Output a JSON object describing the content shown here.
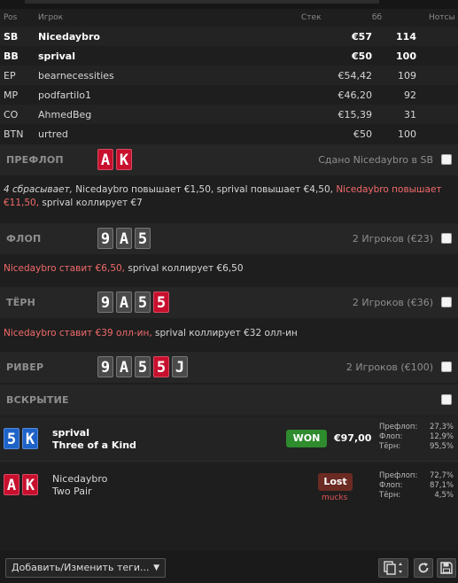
{
  "table": {
    "headers": {
      "pos": "Pos",
      "player": "Игрок",
      "stack": "Стек",
      "bb": "бб",
      "notes": "Нотсы"
    },
    "rows": [
      {
        "pos": "SB",
        "player": "Nicedaybro",
        "stack": "€57",
        "bb": "114",
        "bold": true
      },
      {
        "pos": "BB",
        "player": "sprival",
        "stack": "€50",
        "bb": "100",
        "bold": true
      },
      {
        "pos": "EP",
        "player": "bearnecessities",
        "stack": "€54,42",
        "bb": "109",
        "bold": false
      },
      {
        "pos": "MP",
        "player": "podfartilo1",
        "stack": "€46,20",
        "bb": "92",
        "bold": false
      },
      {
        "pos": "CO",
        "player": "AhmedBeg",
        "stack": "€15,39",
        "bb": "31",
        "bold": false
      },
      {
        "pos": "BTN",
        "player": "urtred",
        "stack": "€50",
        "bb": "100",
        "bold": false
      }
    ]
  },
  "preflop": {
    "label": "ПРЕФЛОП",
    "info": "Сдано Nicedaybro в SB",
    "action": {
      "fold": "4 сбрасывает,",
      "p1": " Nicedaybro повышает €1,50, sprival повышает €4,50, ",
      "hero": "Nicedaybro повышает €11,50,",
      "p2": " sprival коллирует €7"
    }
  },
  "flop": {
    "label": "ФЛОП",
    "info": "2 Игроков (€23)",
    "action": {
      "hero": "Nicedaybro ставит €6,50,",
      "rest": " sprival коллирует €6,50"
    }
  },
  "turn": {
    "label": "ТЁРН",
    "info": "2 Игроков (€36)",
    "action": {
      "hero": "Nicedaybro ставит €39 олл-ин,",
      "rest": " sprival коллирует €32 олл-ин"
    }
  },
  "river": {
    "label": "РИВЕР",
    "info": "2 Игроков (€100)"
  },
  "showdown": {
    "label": "ВСКРЫТИЕ",
    "winner": {
      "name": "sprival",
      "hand": "Three of a Kind",
      "badge": "WON",
      "amount": "€97,00",
      "eq": [
        {
          "k": "Префлоп:",
          "v": "27,3%"
        },
        {
          "k": "Флоп:",
          "v": "12,9%"
        },
        {
          "k": "Тёрн:",
          "v": "95,5%"
        }
      ]
    },
    "loser": {
      "name": "Nicedaybro",
      "hand": "Two Pair",
      "badge": "Lost",
      "note": "mucks",
      "eq": [
        {
          "k": "Префлоп:",
          "v": "72,7%"
        },
        {
          "k": "Флоп:",
          "v": "87,1%"
        },
        {
          "k": "Тёрн:",
          "v": "4,5%"
        }
      ]
    }
  },
  "cards": {
    "hero": [
      {
        "r": "A",
        "s": "h"
      },
      {
        "r": "K",
        "s": "h"
      }
    ],
    "board": [
      {
        "r": "9",
        "s": "s"
      },
      {
        "r": "A",
        "s": "s"
      },
      {
        "r": "5",
        "s": "s"
      },
      {
        "r": "5",
        "s": "h"
      },
      {
        "r": "J",
        "s": "s"
      }
    ],
    "villain": [
      {
        "r": "5",
        "s": "d"
      },
      {
        "r": "K",
        "s": "d"
      }
    ]
  },
  "footer": {
    "tags_label": "Добавить/Изменить теги...",
    "icons": [
      "copy-icon",
      "refresh-icon",
      "save-icon"
    ]
  },
  "colors": {
    "hearts": "#c8102e",
    "spades": "#4a4a4a",
    "diamonds": "#1e63c8",
    "hero_action": "#f26a6a",
    "won": "#2e8b2e",
    "lost": "#6b2a22"
  }
}
